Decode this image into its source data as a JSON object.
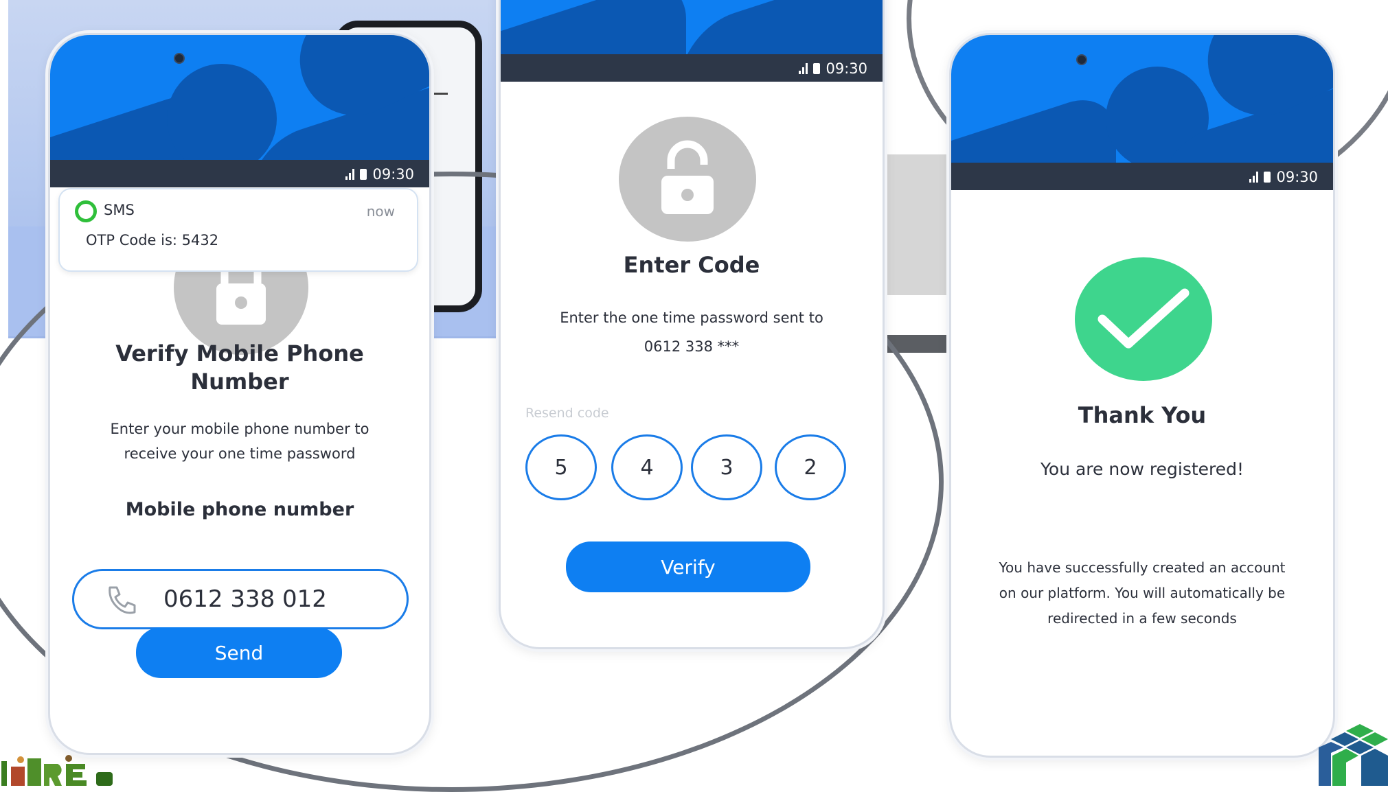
{
  "colors": {
    "primary": "#0e7ff2",
    "primary_dark": "#0b58b3",
    "status_bar": "#2d3748",
    "success": "#3ed58d",
    "lock_gray": "#c4c4c4",
    "sms_green": "#2fbf3a"
  },
  "status_bar": {
    "time": "09:30"
  },
  "screen_verify": {
    "notification": {
      "app": "SMS",
      "time": "now",
      "message": "OTP Code is: 5432"
    },
    "title": "Verify Mobile Phone Number",
    "description": "Enter your mobile phone number to receive your one time password",
    "field_label": "Mobile phone number",
    "phone_value": "0612 338 012",
    "send_label": "Send",
    "icons": [
      "lock-icon",
      "phone-icon"
    ]
  },
  "screen_code": {
    "title": "Enter Code",
    "description": "Enter the one time password sent to",
    "masked_number": "0612 338 ***",
    "resend_label": "Resend code",
    "digits": [
      "5",
      "4",
      "3",
      "2"
    ],
    "verify_label": "Verify",
    "icons": [
      "unlock-icon"
    ]
  },
  "screen_thanks": {
    "title": "Thank You",
    "subtitle": "You are now registered!",
    "message": "You have successfully created an account on our platform. You will automatically be redirected in a few seconds",
    "icons": [
      "check-circle-icon"
    ]
  }
}
